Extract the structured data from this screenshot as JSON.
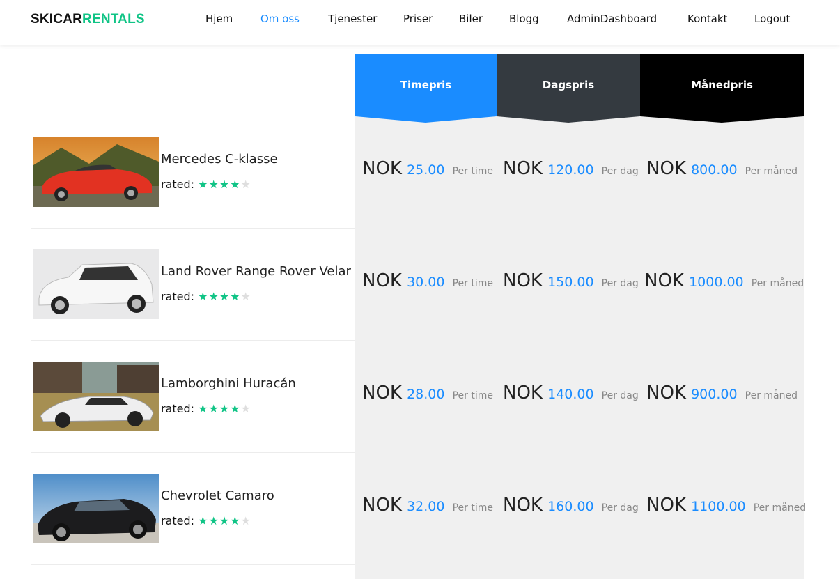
{
  "brand": {
    "part1": "SKICAR",
    "part2": "RENTALS"
  },
  "nav": [
    "Hjem",
    "Om oss",
    "Tjenester",
    "Priser",
    "Biler",
    "Blogg",
    "AdminDashboard",
    "Kontakt",
    "Logout"
  ],
  "nav_active": "Om oss",
  "tabs": [
    {
      "label": "Timepris",
      "color": "#1a8cff"
    },
    {
      "label": "Dagspris",
      "color": "#343a40"
    },
    {
      "label": "Månedpris",
      "color": "#000000"
    }
  ],
  "colors": {
    "accent": "#1a8cff",
    "brand_green": "#10c486",
    "star_on": "#10c486",
    "star_off": "#dedede",
    "panel": "#f0f0f0"
  },
  "rated_label": "rated:",
  "currency": "NOK",
  "per_labels": {
    "hour": "Per time",
    "day": "Per dag",
    "month": "Per måned"
  },
  "cars": [
    {
      "name": "Mercedes C-klasse",
      "rating": 4,
      "max_rating": 5,
      "hour": "25.00",
      "day": "120.00",
      "month": "800.00"
    },
    {
      "name": "Land Rover Range Rover Velar",
      "rating": 4,
      "max_rating": 5,
      "hour": "30.00",
      "day": "150.00",
      "month": "1000.00"
    },
    {
      "name": "Lamborghini Huracán",
      "rating": 4,
      "max_rating": 5,
      "hour": "28.00",
      "day": "140.00",
      "month": "900.00"
    },
    {
      "name": "Chevrolet Camaro",
      "rating": 4,
      "max_rating": 5,
      "hour": "32.00",
      "day": "160.00",
      "month": "1100.00"
    }
  ]
}
